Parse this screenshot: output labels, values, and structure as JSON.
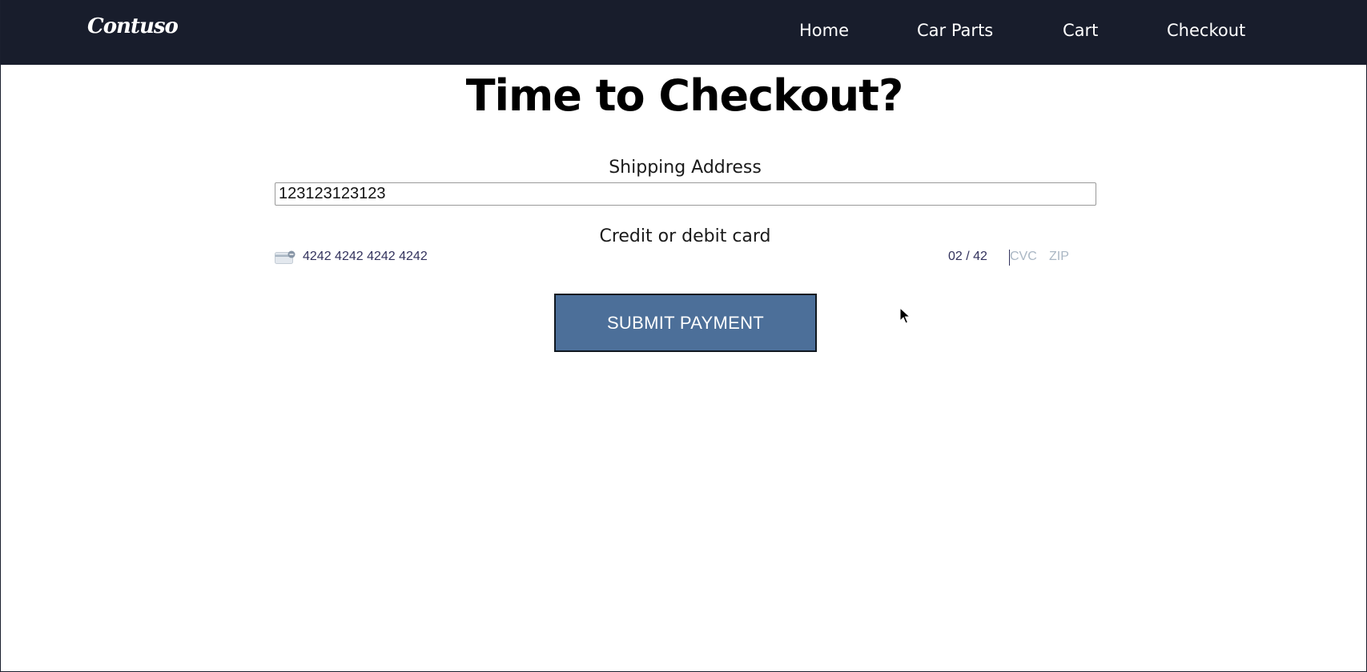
{
  "brand": {
    "name": "Contuso"
  },
  "nav": {
    "items": [
      {
        "label": "Home"
      },
      {
        "label": "Car Parts"
      },
      {
        "label": "Cart"
      },
      {
        "label": "Checkout"
      }
    ]
  },
  "page": {
    "title": "Time to Checkout?"
  },
  "shipping": {
    "label": "Shipping Address",
    "value": "123123123123"
  },
  "card": {
    "label": "Credit or debit card",
    "brand_icon": "generic-credit-card-icon",
    "number": "4242 4242 4242 4242",
    "expiry": "02 / 42",
    "cvc_placeholder": "CVC",
    "zip_placeholder": "ZIP"
  },
  "submit": {
    "label": "SUBMIT PAYMENT"
  },
  "colors": {
    "navbar_background": "#181d2c",
    "button_background": "#4c6f99",
    "button_text": "#ffffff",
    "card_text": "#32325d",
    "card_placeholder": "#aab7c4"
  }
}
